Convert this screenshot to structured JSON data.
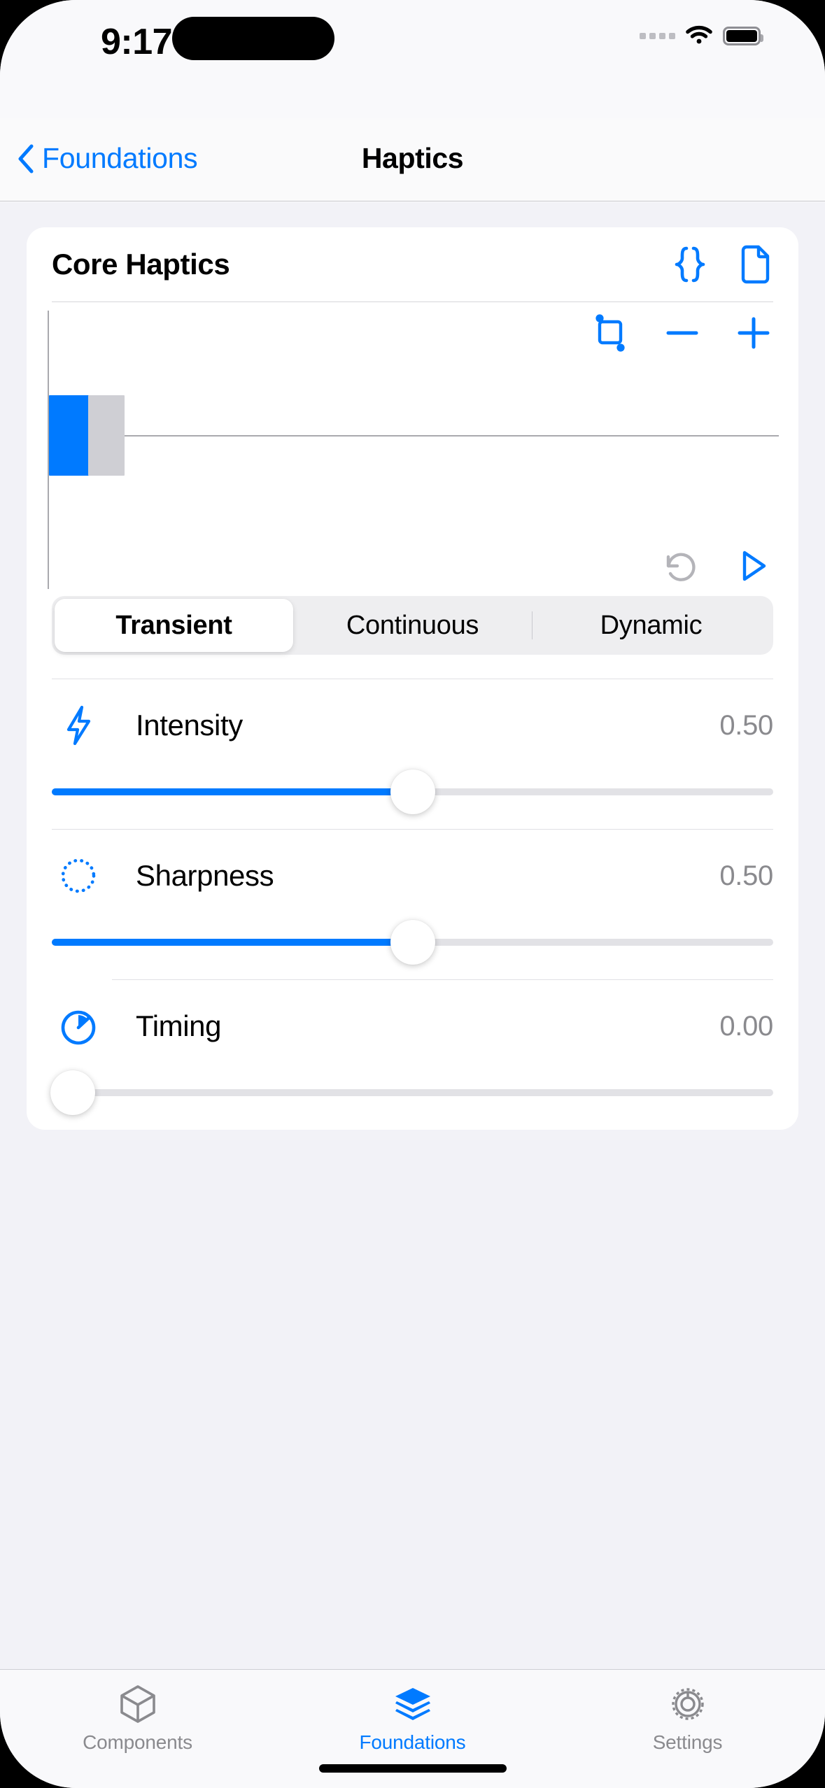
{
  "status_bar": {
    "time": "9:17",
    "cellular_icon": "cellular-dots-icon",
    "wifi_icon": "wifi-icon",
    "battery_icon": "battery-icon"
  },
  "nav_bar": {
    "back_icon": "chevron-left-icon",
    "back_label": "Foundations",
    "title": "Haptics"
  },
  "card": {
    "title": "Core Haptics",
    "actions": [
      {
        "name": "json-braces-icon",
        "label": "{}"
      },
      {
        "name": "document-icon",
        "label": ""
      }
    ]
  },
  "editor": {
    "toolbar": [
      {
        "name": "selection-crop-icon",
        "label": ""
      },
      {
        "name": "minus-icon",
        "label": "−"
      },
      {
        "name": "plus-icon",
        "label": "+"
      }
    ],
    "actions": [
      {
        "name": "reset-icon",
        "label": ""
      },
      {
        "name": "play-icon",
        "label": "▷"
      }
    ],
    "events": [
      {
        "name": "selected-event",
        "color": "#007aff",
        "selected": true
      },
      {
        "name": "event",
        "color": "#cfcfd4",
        "selected": false
      }
    ]
  },
  "segmented_control": {
    "selected": "Transient",
    "options": [
      "Transient",
      "Continuous",
      "Dynamic"
    ]
  },
  "parameters": [
    {
      "icon": "bolt-icon",
      "label": "Intensity",
      "value": "0.50",
      "fill_percent": 50
    },
    {
      "icon": "dotted-circle-icon",
      "label": "Sharpness",
      "value": "0.50",
      "fill_percent": 50
    },
    {
      "icon": "timer-icon",
      "label": "Timing",
      "value": "0.00",
      "fill_percent": 0
    }
  ],
  "tab_bar": {
    "active": "Foundations",
    "tabs": [
      {
        "icon": "cube-icon",
        "label": "Components"
      },
      {
        "icon": "layers-icon",
        "label": "Foundations"
      },
      {
        "icon": "gear-icon",
        "label": "Settings"
      }
    ]
  },
  "colors": {
    "accent": "#007aff",
    "inactive": "#8a8a8e",
    "event_inactive": "#cfcfd4",
    "background": "#f2f2f7"
  }
}
